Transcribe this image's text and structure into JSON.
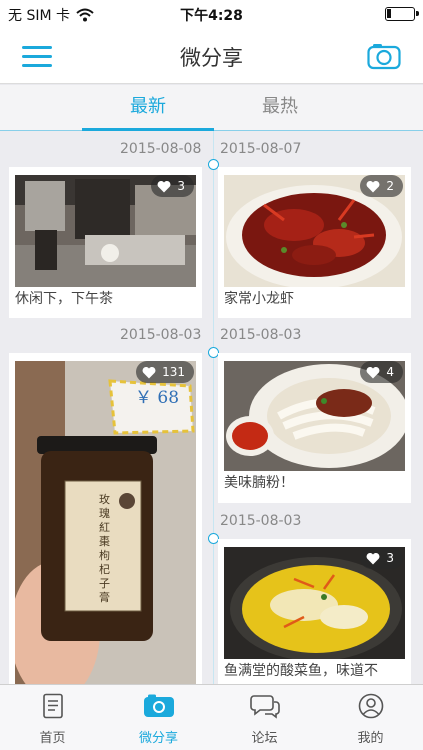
{
  "status_bar": {
    "carrier": "无 SIM 卡",
    "time": "下午4:28"
  },
  "nav": {
    "title": "微分享"
  },
  "tabs": [
    {
      "label": "最新"
    },
    {
      "label": "最热"
    }
  ],
  "feed": [
    {
      "date": "2015-08-08",
      "caption": "休闲下，下午茶",
      "likes": "3"
    },
    {
      "date": "2015-08-07",
      "caption": "家常小龙虾",
      "likes": "2"
    },
    {
      "date": "2015-08-03",
      "caption": "",
      "likes": "131",
      "price_tag": "￥ 68",
      "jar_label": "玫瑰紅棗枸杞子膏"
    },
    {
      "date": "2015-08-03",
      "caption": "美味腩粉！",
      "likes": "4"
    },
    {
      "date": "2015-08-03",
      "caption": "鱼满堂的酸菜鱼，味道不",
      "likes": "3"
    }
  ],
  "tabbar": [
    {
      "label": "首页",
      "icon": "document-icon"
    },
    {
      "label": "微分享",
      "icon": "camera-icon"
    },
    {
      "label": "论坛",
      "icon": "chat-bubbles-icon"
    },
    {
      "label": "我的",
      "icon": "user-icon"
    }
  ],
  "colors": {
    "accent": "#1ba9dc",
    "background": "#ececf0"
  }
}
